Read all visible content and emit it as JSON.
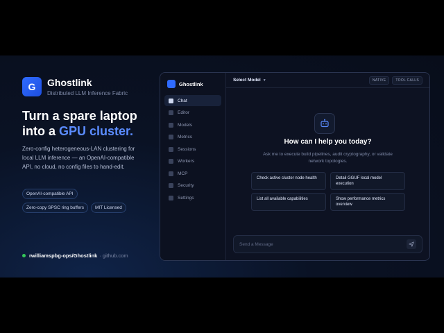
{
  "brand": {
    "initial": "G",
    "name": "Ghostlink",
    "tagline": "Distributed LLM Inference Fabric"
  },
  "hero": {
    "headline_line1": "Turn a spare laptop",
    "headline_prefix": "into a ",
    "headline_accent": "GPU cluster.",
    "description": "Zero-config heterogeneous-LAN clustering for local LLM inference — an OpenAI-compatible API, no cloud, no config files to hand-edit.",
    "tags": [
      "OpenAI-compatible API",
      "Zero-copy SPSC ring buffers",
      "MIT Licensed"
    ]
  },
  "repo": {
    "name": "rwilliamspbg-ops/Ghostlink",
    "host": "· github.com"
  },
  "app": {
    "title": "Ghostlink",
    "nav": [
      "Chat",
      "Editor",
      "Models",
      "Metrics",
      "Sessions",
      "Workers",
      "MCP",
      "Security",
      "Settings"
    ],
    "active_nav": "Chat",
    "model_select": "Select Model",
    "badges": [
      "NATIVE",
      "TOOL CALLS"
    ],
    "greeting": "How can I help you today?",
    "subtext": "Ask me to execute build pipelines, audit cryptography, or validate network topologies.",
    "suggestions": [
      "Check active cluster node health",
      "Detail GGUF local model execution",
      "List all available capabilities",
      "Show performance metrics overview"
    ],
    "composer_placeholder": "Send a Message"
  },
  "colors": {
    "accent": "#5b8cff",
    "brand": "#2f6bff",
    "status_online": "#34c759"
  }
}
